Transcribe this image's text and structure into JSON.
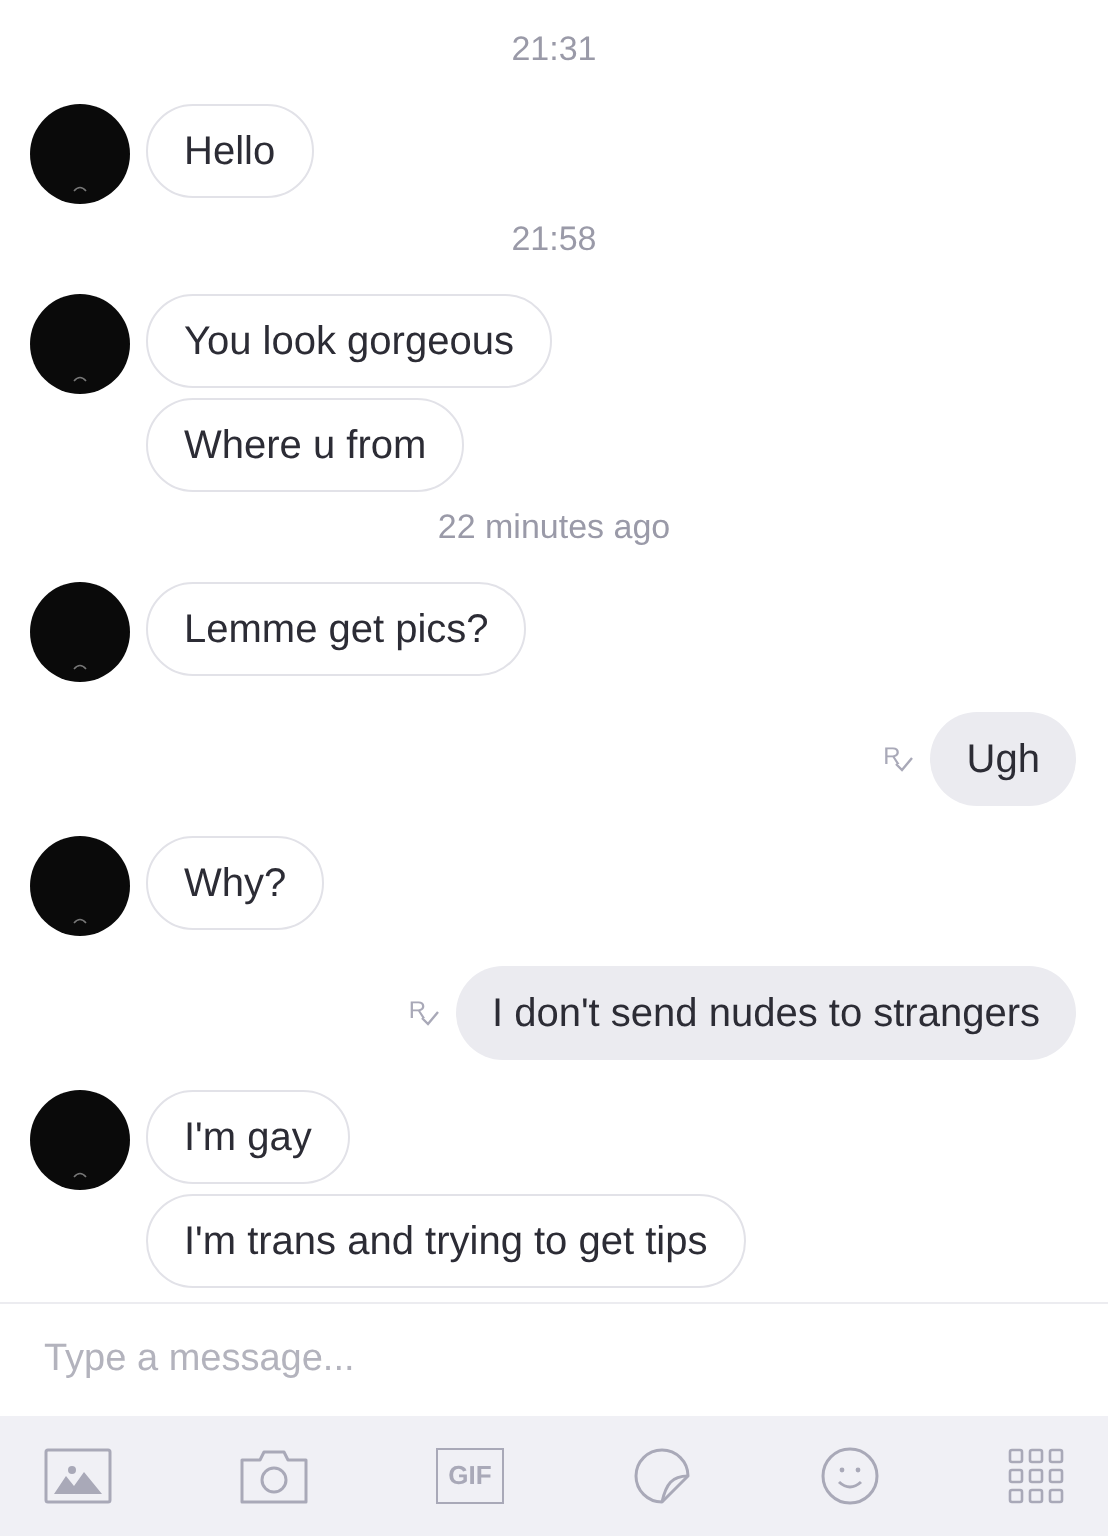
{
  "messages": [
    {
      "kind": "timestamp",
      "text": "21:31"
    },
    {
      "kind": "incoming",
      "bubbles": [
        "Hello"
      ]
    },
    {
      "kind": "timestamp",
      "text": "21:58"
    },
    {
      "kind": "incoming",
      "bubbles": [
        "You look gorgeous",
        "Where u from"
      ]
    },
    {
      "kind": "timestamp",
      "text": "22 minutes ago"
    },
    {
      "kind": "incoming",
      "bubbles": [
        "Lemme get pics?"
      ]
    },
    {
      "kind": "outgoing",
      "receipt": "R",
      "text": "Ugh"
    },
    {
      "kind": "incoming",
      "bubbles": [
        "Why?"
      ]
    },
    {
      "kind": "outgoing",
      "receipt": "R",
      "text": "I don't send nudes to strangers"
    },
    {
      "kind": "incoming",
      "bubbles": [
        "I'm gay",
        "I'm trans and trying to get tips"
      ]
    }
  ],
  "composer": {
    "placeholder": "Type a message..."
  },
  "toolbar": {
    "gif_label": "GIF"
  }
}
